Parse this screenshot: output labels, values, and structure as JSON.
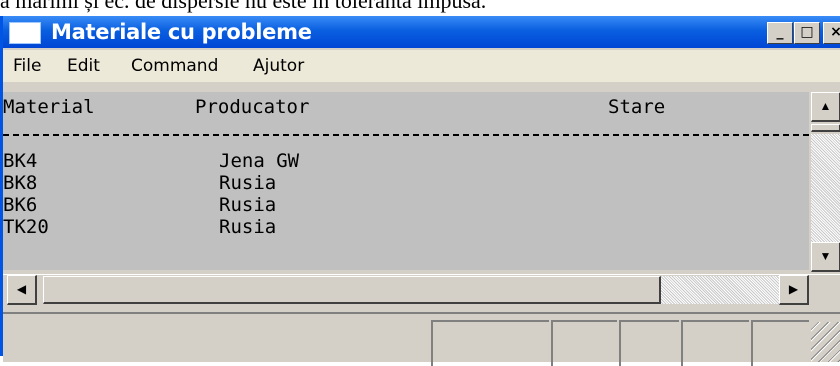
{
  "document": {
    "text": "ă mărimi și ec. de dispersie nu este în toleranta impusă."
  },
  "window": {
    "title": "Materiale cu probleme",
    "buttons": {
      "minimize": "_",
      "maximize": "□",
      "close": "×"
    }
  },
  "menu": {
    "items": [
      {
        "label": "File"
      },
      {
        "label": "Edit"
      },
      {
        "label": "Command"
      },
      {
        "label": "Ajutor"
      }
    ]
  },
  "table": {
    "headers": {
      "material": "Material",
      "producator": "Producator",
      "stare": "Stare"
    },
    "separator": "---------------------------------------------------------------------",
    "rows": [
      {
        "material": "BK4",
        "producator": "Jena GW"
      },
      {
        "material": "BK8",
        "producator": "Rusia"
      },
      {
        "material": "BK6",
        "producator": "Rusia"
      },
      {
        "material": "TK20",
        "producator": "Rusia"
      }
    ]
  },
  "scrollbar": {
    "up": "▲",
    "down": "▼",
    "left": "◀",
    "right": "▶"
  },
  "colors": {
    "titlebar": "#0a5fe0",
    "client": "#c0c0c0",
    "chrome": "#d4d0c8"
  }
}
